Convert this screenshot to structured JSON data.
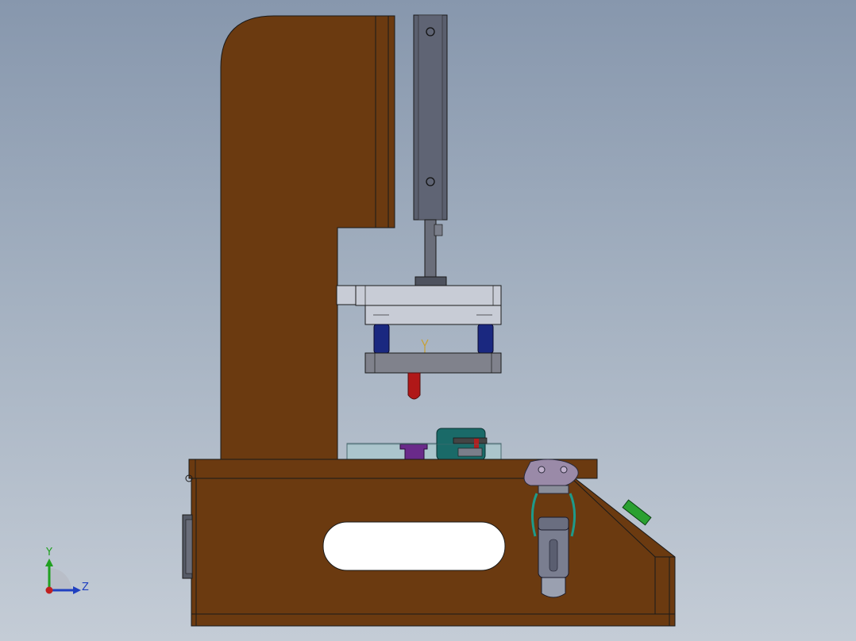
{
  "viewport": {
    "background_top": "#8797ad",
    "background_bottom": "#c4ccd6"
  },
  "colors": {
    "wood": "#6b3a10",
    "wood_dark": "#5a2f0c",
    "outline": "#1a1a1a",
    "steel": "#5a5f6e",
    "plate_light": "#c8ccd6",
    "plate_dark": "#80828c",
    "guide_post": "#1a2880",
    "punch_red": "#b01818",
    "clamp_purple": "#9a8aa8",
    "clamp_teal": "#1e9a8a",
    "green_button": "#2aa030",
    "block_teal": "#1a6a68",
    "purple_part": "#6a2a8a",
    "glass_fixture": "#a8c8cc"
  },
  "triad": {
    "y_label": "Y",
    "z_label": "Z",
    "y_color": "#20a020",
    "z_color": "#2040c0",
    "origin_color": "#c02020"
  }
}
